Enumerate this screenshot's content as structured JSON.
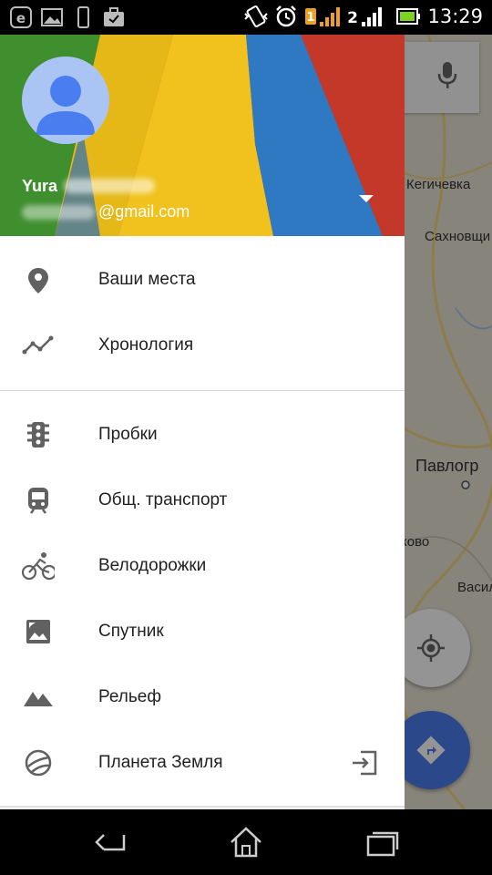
{
  "status_bar": {
    "time": "13:29",
    "sim1_badge": "1",
    "sim2_badge": "2",
    "left_icons": [
      "e-mail-icon",
      "image-icon",
      "phone-icon",
      "briefcase-icon"
    ],
    "right_icons": [
      "vibrate-icon",
      "alarm-icon",
      "sim1-signal-icon",
      "sim2-signal-icon",
      "battery-icon"
    ]
  },
  "map": {
    "labels": [
      "Кегичевка",
      "Сахновщи",
      "Павлогр",
      "ково",
      "Васил"
    ]
  },
  "drawer": {
    "account": {
      "name": "Yura",
      "email_suffix": "@gmail.com"
    },
    "primary_items": [
      {
        "label": "Ваши места",
        "icon": "place-pin-icon"
      },
      {
        "label": "Хронология",
        "icon": "timeline-icon"
      }
    ],
    "layer_items": [
      {
        "label": "Пробки",
        "icon": "traffic-light-icon"
      },
      {
        "label": "Общ. транспорт",
        "icon": "train-icon"
      },
      {
        "label": "Велодорожки",
        "icon": "bicycle-icon"
      },
      {
        "label": "Спутник",
        "icon": "satellite-image-icon"
      },
      {
        "label": "Рельеф",
        "icon": "terrain-icon"
      },
      {
        "label": "Планета Земля",
        "icon": "earth-globe-icon",
        "trailing_icon": "open-external-icon"
      }
    ]
  },
  "nav_bar": {
    "icons": [
      "back-icon",
      "home-icon",
      "recent-apps-icon"
    ]
  },
  "colors": {
    "drawer_bg": "#ffffff",
    "text_primary": "#212121",
    "icon_grey": "#616161",
    "fab_blue": "#4a7df0",
    "avatar_bg": "#aac4f4",
    "avatar_fg": "#4a7df0"
  }
}
